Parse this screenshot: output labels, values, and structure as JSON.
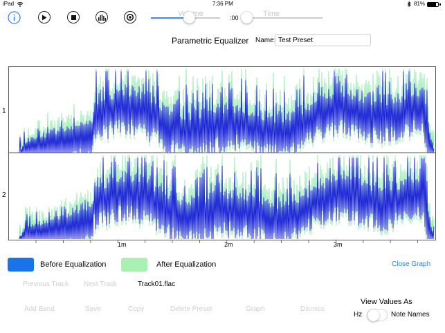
{
  "status_bar": {
    "device": "iPad",
    "time": "7:36 PM",
    "battery_percent": "81%",
    "battery_level": 0.81
  },
  "toolbar": {
    "info_icon": "info-icon",
    "play_icon": "play-icon",
    "stop_icon": "stop-icon",
    "spectrum_icon": "spectrum-icon",
    "repeat_icon": "repeat-icon",
    "volume_label": "Volume",
    "volume_level": 0.5,
    "time_readout": ":00",
    "time_label": "Time",
    "time_level": 0
  },
  "header": {
    "title": "Parametric Equalizer",
    "name_label": "Name:",
    "name_value": "Test Preset"
  },
  "graph": {
    "channels": [
      "1",
      "2"
    ],
    "time_ticks": [
      "1m",
      "2m",
      "3m"
    ],
    "before_color": "#1a1adc",
    "after_color": "#88e8a8"
  },
  "legend": {
    "before_label": "Before Equalization",
    "before_color": "#1a73e8",
    "after_label": "After Equalization",
    "after_color": "#a8f0b4",
    "close_label": "Close Graph"
  },
  "track": {
    "previous_label": "Previous Track",
    "next_label": "Next Track",
    "filename": "Track01.flac"
  },
  "actions": {
    "add_band": "Add Band",
    "save": "Save",
    "copy": "Copy",
    "delete_preset": "Delete Preset",
    "graph": "Graph",
    "dismiss": "Dismiss"
  },
  "view_values": {
    "title": "View Values As",
    "left_option": "Hz",
    "right_option": "Note Names",
    "toggle_on": false
  }
}
